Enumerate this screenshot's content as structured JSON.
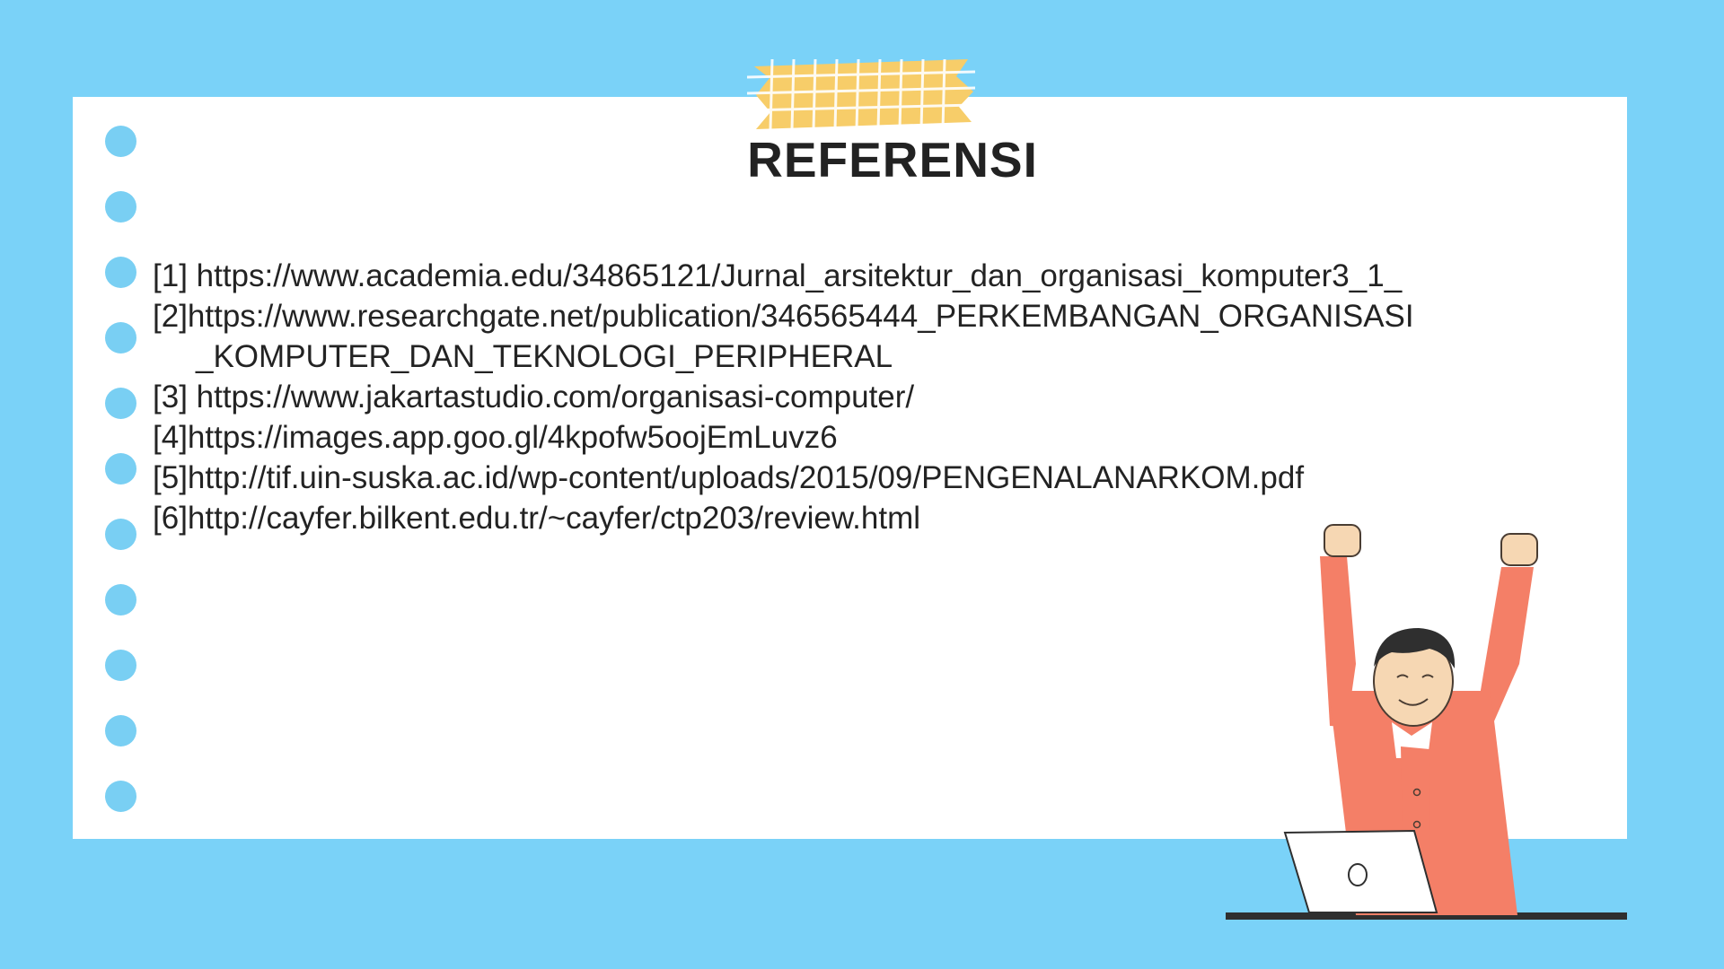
{
  "slide": {
    "title": "REFERENSI",
    "references": [
      "[1] https://www.academia.edu/34865121/Jurnal_arsitektur_dan_organisasi_komputer3_1_",
      "[2]https://www.researchgate.net/publication/346565444_PERKEMBANGAN_ORGANISASI",
      "_KOMPUTER_DAN_TEKNOLOGI_PERIPHERAL",
      "[3] https://www.jakartastudio.com/organisasi-computer/",
      "[4]https://images.app.goo.gl/4kpofw5oojEmLuvz6",
      "[5]http://tif.uin-suska.ac.id/wp-content/uploads/2015/09/PENGENALANARKOM.pdf",
      "[6]http://cayfer.bilkent.edu.tr/~cayfer/ctp203/review.html"
    ]
  },
  "colors": {
    "background": "#7ad2f8",
    "paper": "#ffffff",
    "holes": "#79cff3",
    "tape": "#f7cd69",
    "shirt": "#f47f67",
    "skin": "#f6d7b3",
    "hair": "#2f2f2f",
    "text": "#232323"
  },
  "icons": {
    "tape": "washi-tape-icon",
    "holes": "paper-hole-icon",
    "illustration": "celebrating-person-illustration"
  }
}
